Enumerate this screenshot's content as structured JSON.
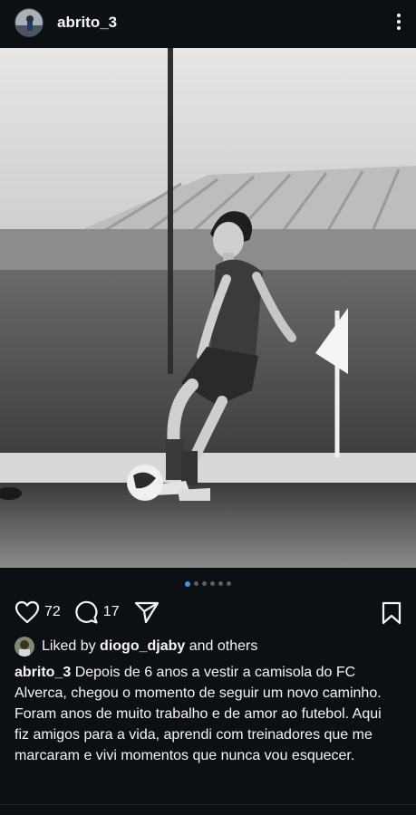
{
  "post": {
    "username": "abrito_3",
    "likes_count": "72",
    "comments_count": "17",
    "liked_by_prefix": "Liked by",
    "liked_by_user": "diogo_djaby",
    "liked_by_suffix": "and others",
    "caption_user": "abrito_3",
    "caption_text": "Depois de 6 anos a vestir a camisola do FC Alverca, chegou o momento de seguir um novo caminho.\nForam anos de muito trabalho e de amor ao futebol. Aqui fiz amigos para a vida, aprendi com treinadores que me marcaram e vivi momentos que nunca vou esquecer."
  },
  "carousel": {
    "total": 6,
    "active": 1
  },
  "colors": {
    "background": "#0c1014",
    "accent": "#3897f0"
  },
  "icons": [
    "more-vertical-icon",
    "heart-icon",
    "comment-icon",
    "share-icon",
    "bookmark-icon"
  ]
}
